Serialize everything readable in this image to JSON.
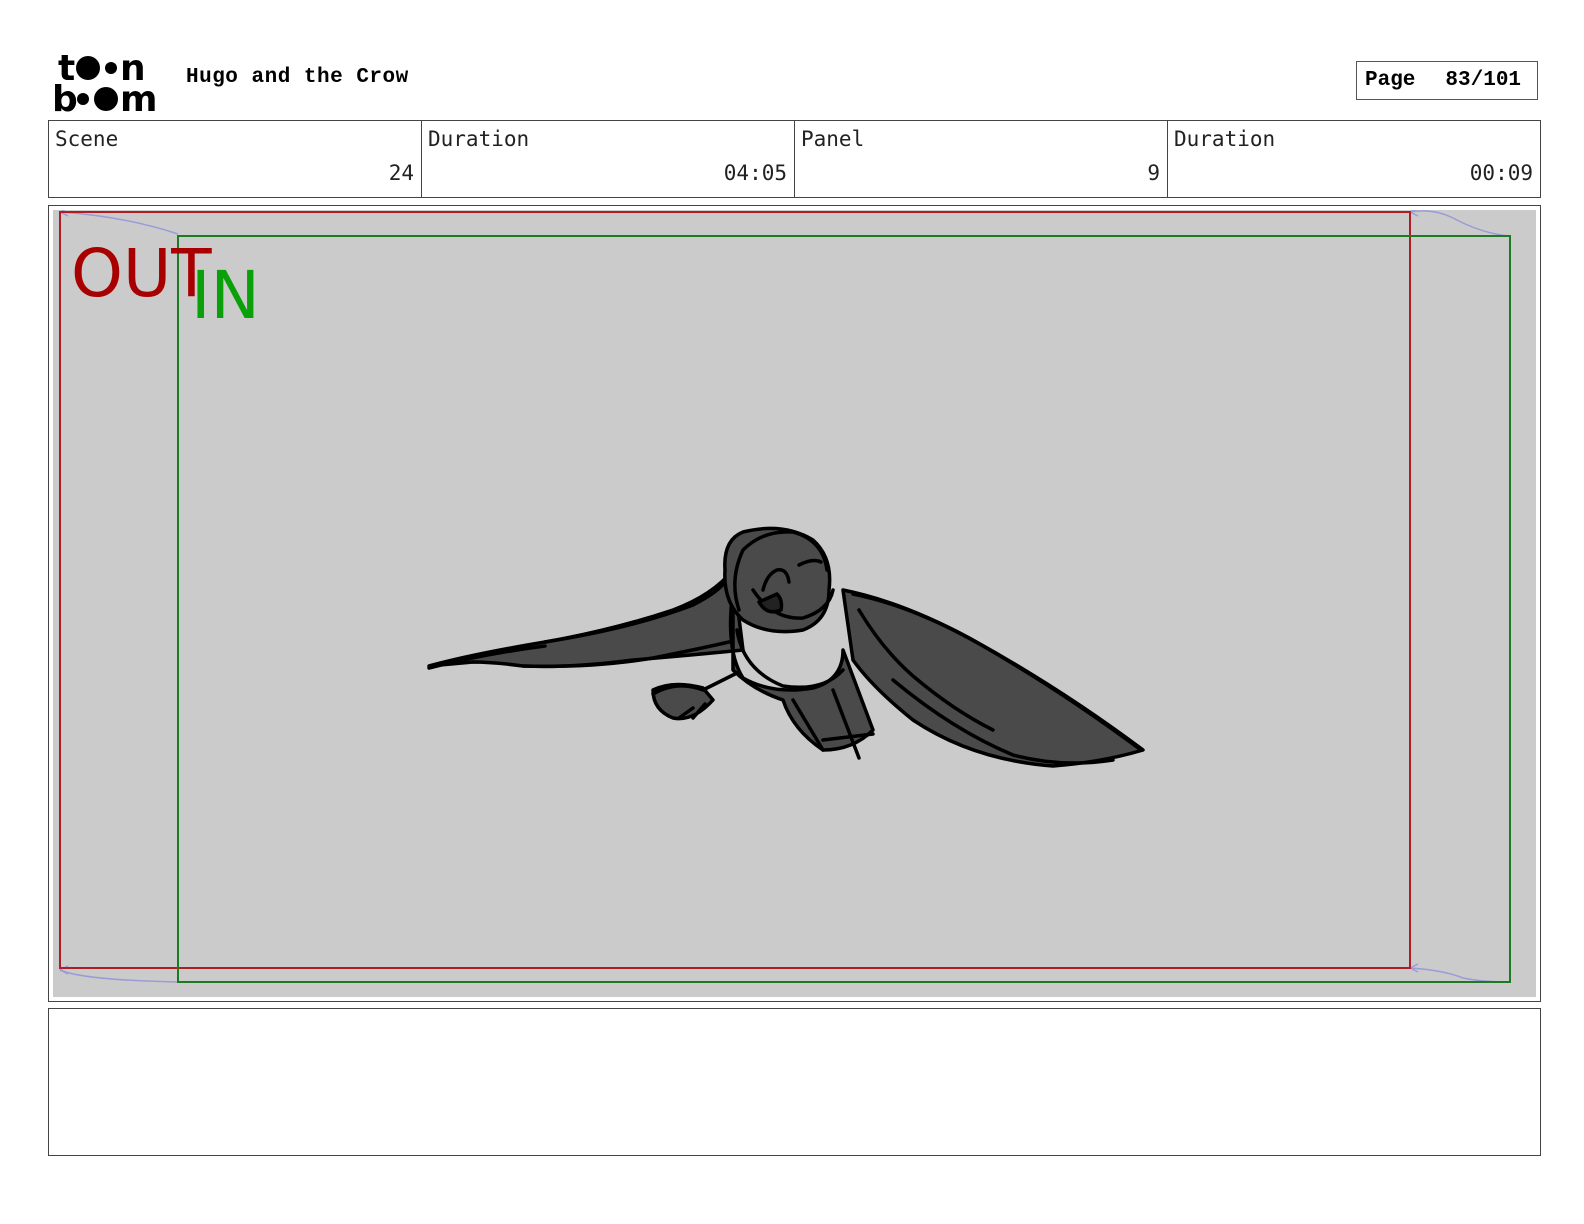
{
  "header": {
    "project_title": "Hugo and the Crow",
    "page_label": "Page",
    "page_value": "83/101"
  },
  "info": {
    "scene_label": "Scene",
    "scene_value": "24",
    "scene_duration_label": "Duration",
    "scene_duration_value": "04:05",
    "panel_label": "Panel",
    "panel_value": "9",
    "panel_duration_label": "Duration",
    "panel_duration_value": "00:09"
  },
  "panel": {
    "out_label": "OUT",
    "in_label": "IN",
    "colors": {
      "background": "#cbcbcb",
      "out_frame": "#b01c24",
      "in_frame": "#1e7a22",
      "out_text": "#a80000",
      "in_text": "#0aa00a",
      "camera_path": "#9b9bd8",
      "crow_fill": "#4a4a4a"
    }
  },
  "notes": {
    "text": ""
  }
}
